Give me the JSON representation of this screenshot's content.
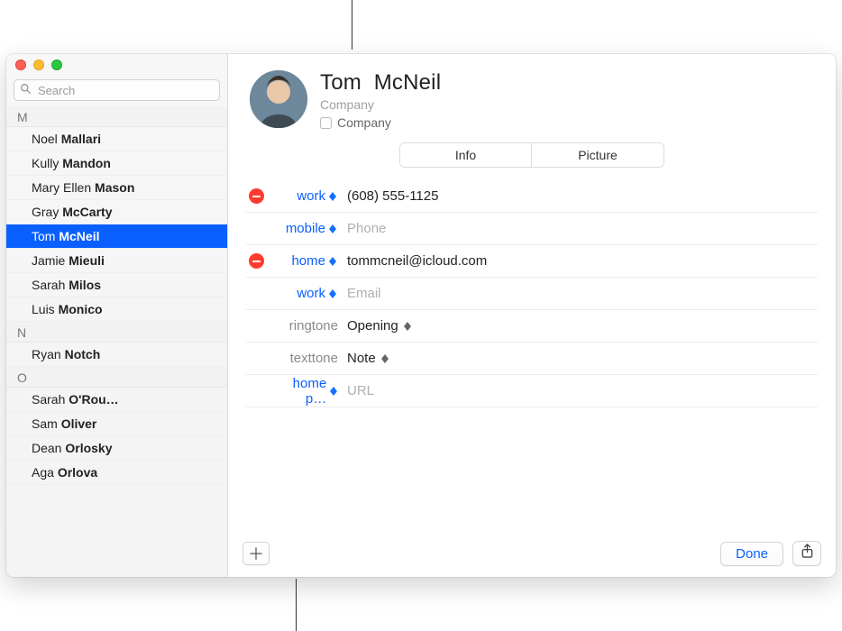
{
  "search": {
    "placeholder": "Search"
  },
  "sidebar": {
    "sections": [
      {
        "letter": "M",
        "items": [
          {
            "first": "Noel",
            "last": "Mallari"
          },
          {
            "first": "Kully",
            "last": "Mandon"
          },
          {
            "first": "Mary Ellen",
            "last": "Mason"
          },
          {
            "first": "Gray",
            "last": "McCarty"
          },
          {
            "first": "Tom",
            "last": "McNeil",
            "selected": true
          },
          {
            "first": "Jamie",
            "last": "Mieuli"
          },
          {
            "first": "Sarah",
            "last": "Milos"
          },
          {
            "first": "Luis",
            "last": "Monico"
          }
        ]
      },
      {
        "letter": "N",
        "items": [
          {
            "first": "Ryan",
            "last": "Notch"
          }
        ]
      },
      {
        "letter": "O",
        "items": [
          {
            "first": "Sarah",
            "last": "O'Rou…"
          },
          {
            "first": "Sam",
            "last": "Oliver"
          },
          {
            "first": "Dean",
            "last": "Orlosky"
          },
          {
            "first": "Aga",
            "last": "Orlova"
          }
        ]
      }
    ]
  },
  "card": {
    "first_name": "Tom",
    "last_name": "McNeil",
    "company_placeholder": "Company",
    "company_checkbox_label": "Company"
  },
  "tabs": {
    "info": "Info",
    "picture": "Picture"
  },
  "fields": {
    "phone_work_label": "work",
    "phone_work_value": "(608) 555-1125",
    "phone_mobile_label": "mobile",
    "phone_mobile_placeholder": "Phone",
    "email_home_label": "home",
    "email_home_value": "tommcneil@icloud.com",
    "email_work_label": "work",
    "email_work_placeholder": "Email",
    "ringtone_label": "ringtone",
    "ringtone_value": "Opening",
    "texttone_label": "texttone",
    "texttone_value": "Note",
    "url_label": "home p…",
    "url_placeholder": "URL"
  },
  "footer": {
    "done": "Done"
  }
}
